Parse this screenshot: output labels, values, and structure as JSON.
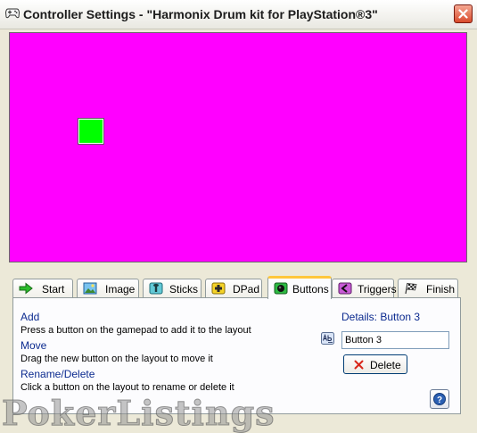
{
  "window": {
    "title": "Controller Settings - \"Harmonix Drum kit for PlayStation®3\"",
    "canvas_background": "#ff00ff",
    "layout_button_color": "#00ff00"
  },
  "tabs": [
    {
      "label": "Start",
      "icon": "green-arrow-icon",
      "active": false
    },
    {
      "label": "Image",
      "icon": "image-icon",
      "active": false
    },
    {
      "label": "Sticks",
      "icon": "stick-icon",
      "active": false
    },
    {
      "label": "DPad",
      "icon": "dpad-icon",
      "active": false
    },
    {
      "label": "Buttons",
      "icon": "button-icon",
      "active": true
    },
    {
      "label": "Triggers",
      "icon": "trigger-icon",
      "active": false
    },
    {
      "label": "Finish",
      "icon": "checkered-flag-icon",
      "active": false
    }
  ],
  "instructions": [
    {
      "heading": "Add",
      "text": "Press a button on the gamepad to add it to the layout"
    },
    {
      "heading": "Move",
      "text": "Drag the new button on the layout to move it"
    },
    {
      "heading": "Rename/Delete",
      "text": "Click a button on the layout to rename or delete it"
    }
  ],
  "details": {
    "title": "Details: Button 3",
    "name_value": "Button 3",
    "delete_label": "Delete"
  },
  "watermark": "PokerListings"
}
